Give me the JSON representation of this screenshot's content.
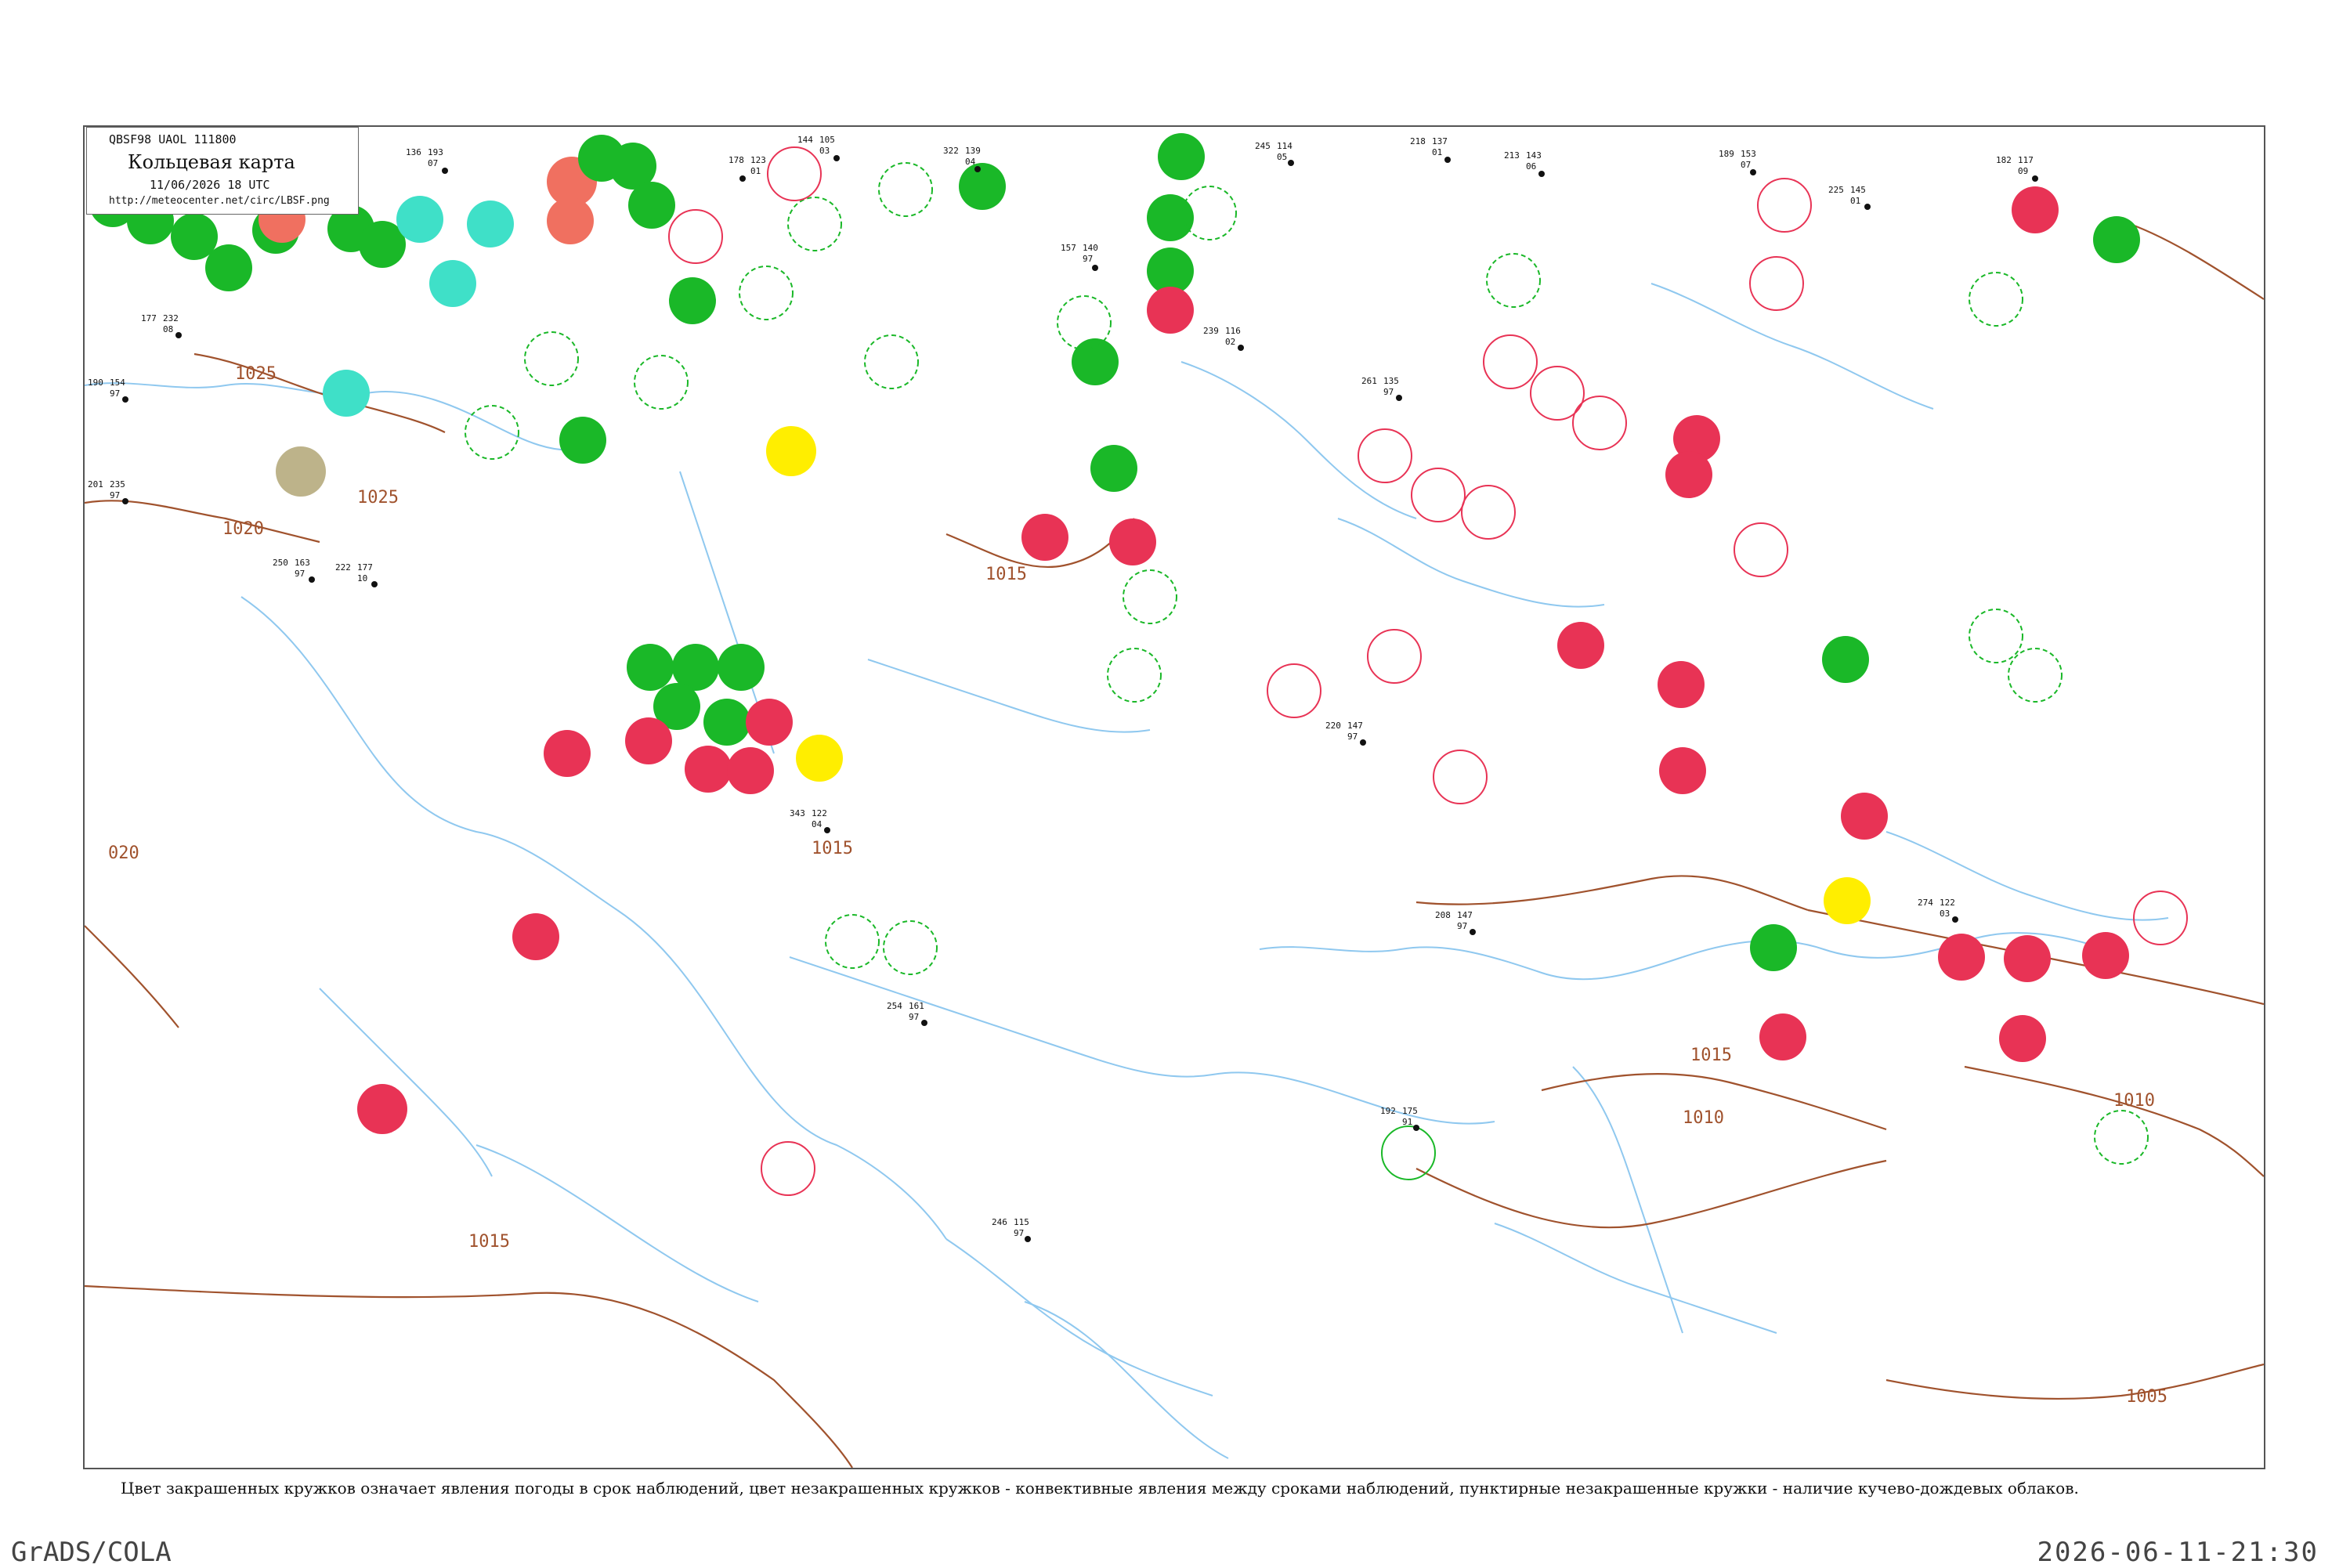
{
  "header": {
    "code": "QBSF98  UAOL  111800",
    "title": "Кольцевая карта",
    "time": "11/06/2026 18 UTC",
    "url": "http://meteocenter.net/circ/LBSF.png"
  },
  "caption": "Цвет закрашенных кружков означает явления погоды в срок наблюдений, цвет незакрашенных кружков - конвективные явления между сроками наблюдений, пунктирные незакрашенные кружки - наличие кучево-дождевых облаков.",
  "footer": {
    "left": "GrADS/COLA",
    "right": "2026-06-11-21:30"
  },
  "colors": {
    "green": "#1ab828",
    "red": "#e83355",
    "cyan": "#3fe0c8",
    "yellow": "#ffee00",
    "salmon": "#f07060",
    "olive": "#bdb38a",
    "isobar": "#a0522d",
    "coast": "#8fc8ef"
  },
  "isobars": [
    {
      "label": "1025"
    },
    {
      "label": "1025"
    },
    {
      "label": "1020"
    },
    {
      "label": "020"
    },
    {
      "label": "1015"
    },
    {
      "label": "1015"
    },
    {
      "label": "1015"
    },
    {
      "label": "1015"
    },
    {
      "label": "1010"
    },
    {
      "label": "1010"
    },
    {
      "label": "1005"
    }
  ],
  "station_labels": [
    {
      "a": "136",
      "b": "193",
      "c": "07"
    },
    {
      "a": "218",
      "b": "137",
      "c": "01"
    },
    {
      "a": "245",
      "b": "114",
      "c": "05"
    },
    {
      "a": "213",
      "b": "143",
      "c": "06"
    },
    {
      "a": "189",
      "b": "153",
      "c": "07"
    },
    {
      "a": "182",
      "b": "117",
      "c": "09"
    },
    {
      "a": "144",
      "b": "105",
      "c": "03"
    },
    {
      "a": "322",
      "b": "139",
      "c": "04"
    },
    {
      "a": "178",
      "b": "123",
      "c": "01"
    },
    {
      "a": "157",
      "b": "140",
      "c": "97"
    },
    {
      "a": "239",
      "b": "116",
      "c": "02"
    },
    {
      "a": "261",
      "b": "135",
      "c": "97"
    },
    {
      "a": "225",
      "b": "145",
      "c": "01"
    },
    {
      "a": "177",
      "b": "232",
      "c": "08"
    },
    {
      "a": "190",
      "b": "154",
      "c": "97"
    },
    {
      "a": "201",
      "b": "235",
      "c": "97"
    },
    {
      "a": "250",
      "b": "163",
      "c": "97"
    },
    {
      "a": "222",
      "b": "177",
      "c": "10"
    },
    {
      "a": "220",
      "b": "147",
      "c": "97"
    },
    {
      "a": "208",
      "b": "147",
      "c": "97"
    },
    {
      "a": "192",
      "b": "175",
      "c": "91"
    },
    {
      "a": "274",
      "b": "122",
      "c": "03"
    },
    {
      "a": "246",
      "b": "115",
      "c": "97"
    },
    {
      "a": "343",
      "b": "122",
      "c": "04"
    },
    {
      "a": "254",
      "b": "161",
      "c": "97"
    }
  ]
}
